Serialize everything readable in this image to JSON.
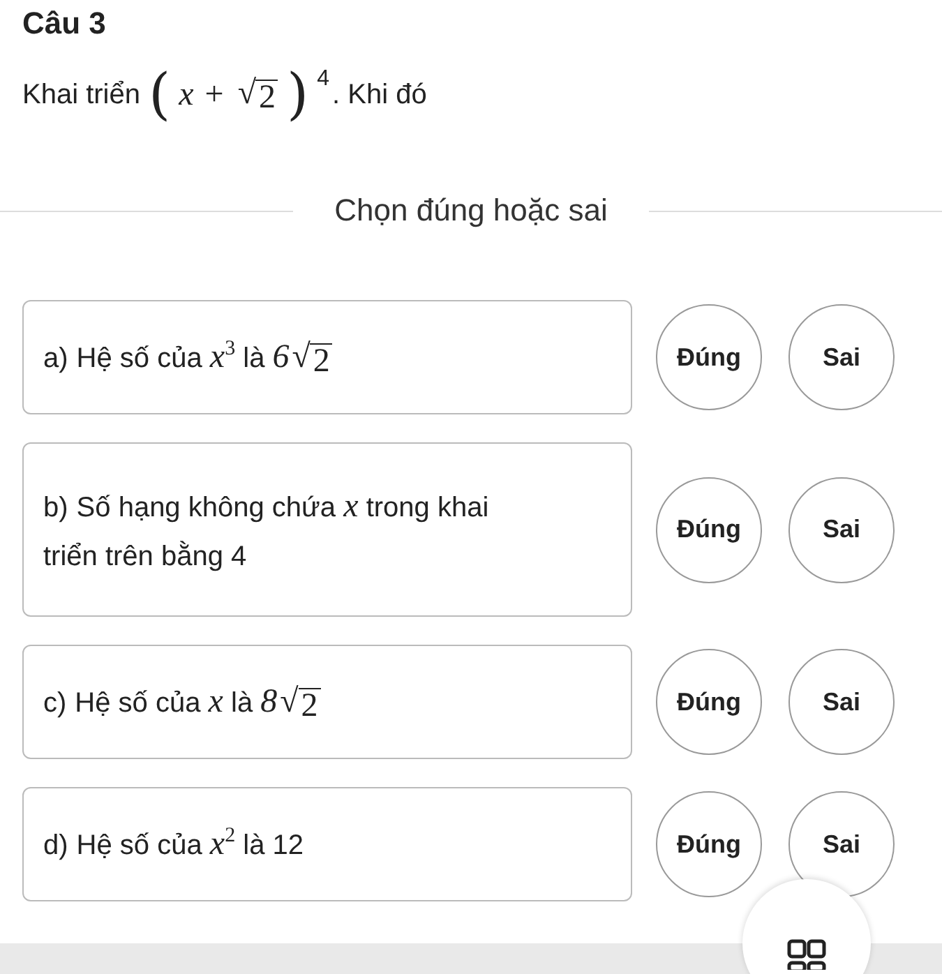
{
  "title": "Câu 3",
  "question": {
    "before": "Khai triển",
    "open": "(",
    "base": "x",
    "plus": "+",
    "radical": "√",
    "radicand": "2",
    "close": ")",
    "exponent": "4",
    "after": ". Khi đó"
  },
  "section_heading": "Chọn đúng hoặc sai",
  "statements": [
    {
      "label": "a)",
      "parts": [
        {
          "kind": "text",
          "text": "Hệ số của "
        },
        {
          "kind": "math",
          "text": "x",
          "sup": "3"
        },
        {
          "kind": "text",
          "text": " là "
        },
        {
          "kind": "math",
          "text": "6"
        },
        {
          "kind": "sqrt",
          "symbol": "√",
          "text": "2"
        }
      ],
      "options": [
        "Đúng",
        "Sai"
      ]
    },
    {
      "label": "b)",
      "parts": [
        {
          "kind": "text",
          "text": "Số hạng không chứa "
        },
        {
          "kind": "math",
          "text": "x"
        },
        {
          "kind": "text",
          "text": " trong khai triển trên bằng 4"
        }
      ],
      "options": [
        "Đúng",
        "Sai"
      ]
    },
    {
      "label": "c)",
      "parts": [
        {
          "kind": "text",
          "text": "Hệ số của "
        },
        {
          "kind": "math",
          "text": "x"
        },
        {
          "kind": "text",
          "text": " là "
        },
        {
          "kind": "math",
          "text": "8"
        },
        {
          "kind": "sqrt",
          "symbol": "√",
          "text": "2"
        }
      ],
      "options": [
        "Đúng",
        "Sai"
      ]
    },
    {
      "label": "d)",
      "parts": [
        {
          "kind": "text",
          "text": "Hệ số của "
        },
        {
          "kind": "math",
          "text": "x",
          "sup": "2"
        },
        {
          "kind": "text",
          "text": " là 12"
        }
      ],
      "options": [
        "Đúng",
        "Sai"
      ]
    }
  ]
}
